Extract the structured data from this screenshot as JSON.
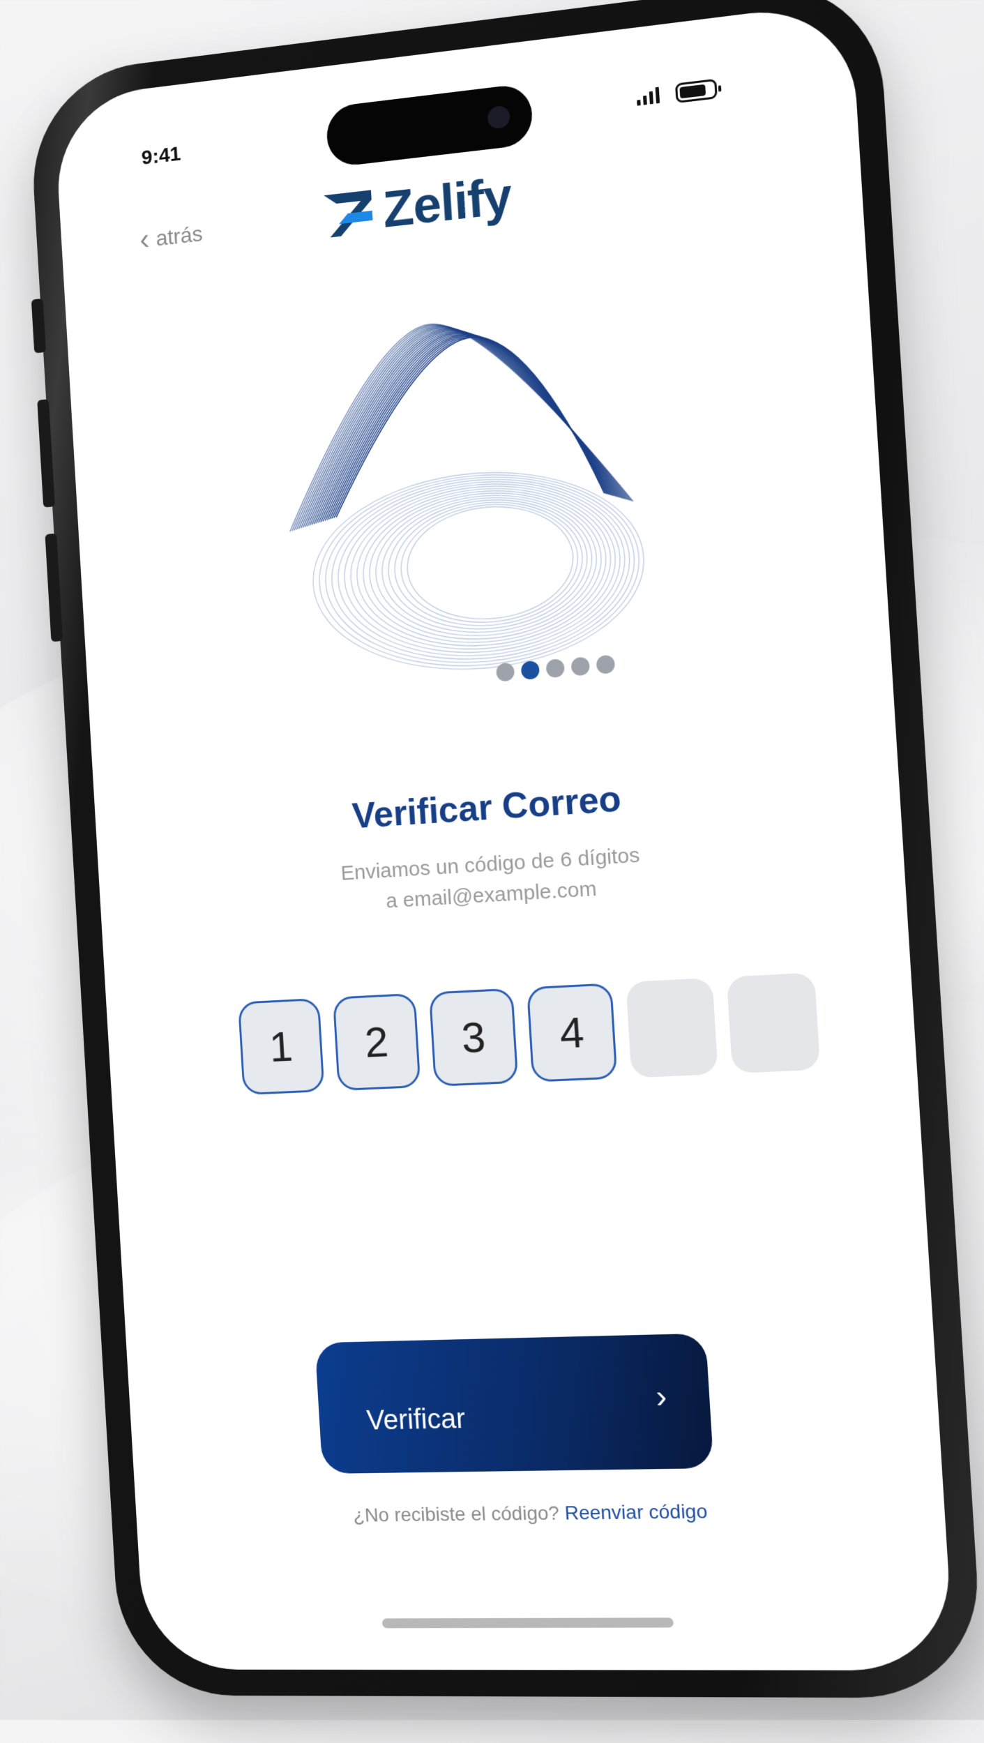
{
  "status_bar": {
    "time": "9:41"
  },
  "nav": {
    "back_label": "atrás"
  },
  "brand": {
    "name": "Zelify",
    "color": "#16416f"
  },
  "carousel": {
    "total": 5,
    "active_index": 1
  },
  "verify": {
    "title": "Verificar Correo",
    "subtitle_line1": "Enviamos un código de 6 dígitos",
    "subtitle_line2": "a email@example.com"
  },
  "code": {
    "digits": [
      "1",
      "2",
      "3",
      "4",
      "",
      ""
    ]
  },
  "actions": {
    "verify_label": "Verificar",
    "resend_prompt": "¿No recibiste el código?",
    "resend_link": "Reenviar código"
  },
  "colors": {
    "accent": "#1b4fa0",
    "title": "#173f86",
    "button": "#0c3d8f"
  }
}
